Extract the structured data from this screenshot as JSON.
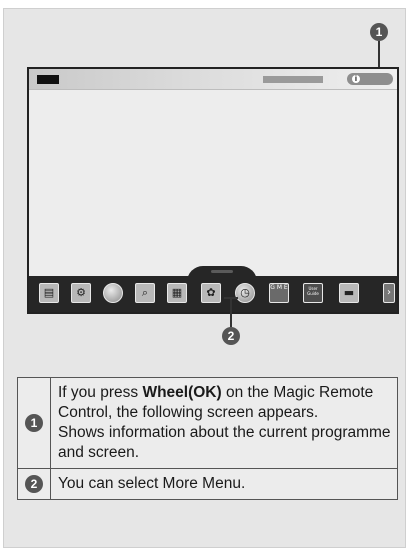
{
  "callouts": [
    "1",
    "2"
  ],
  "menu_icons": [
    "premium-icon",
    "settings-icon",
    "internet-icon",
    "search-icon",
    "epg-icon",
    "photo-icon",
    "time-icon",
    "games-icon",
    "user-guide-icon",
    "input-icon",
    "more-icon"
  ],
  "menu_text": {
    "games": "G M E",
    "user_guide": "User Guide",
    "more": "›"
  },
  "info_icon": "i",
  "rows": [
    {
      "num": "1",
      "pre": "If you press ",
      "bold": "Wheel(OK)",
      "post": " on the Magic Remote Control, the following screen appears.",
      "line2": "Shows information about the current programme and screen."
    },
    {
      "num": "2",
      "text": "You can select More Menu."
    }
  ],
  "colors": {
    "callout": "#555555",
    "menubar": "#262626",
    "background": "#e6e6e6"
  }
}
